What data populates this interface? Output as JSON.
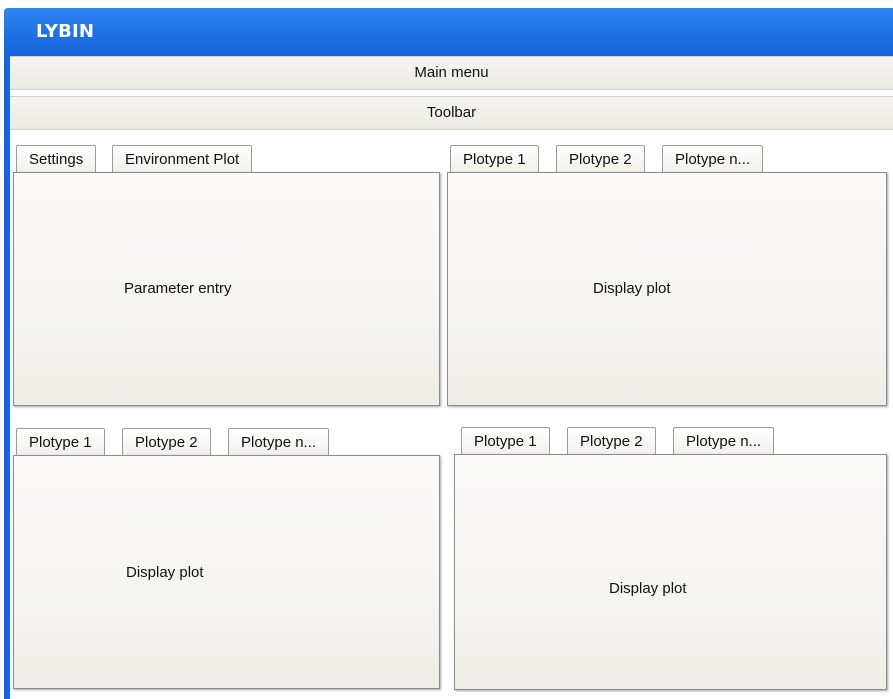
{
  "app": {
    "title": "LYBIN"
  },
  "main_menu": {
    "label": "Main menu"
  },
  "toolbar": {
    "label": "Toolbar"
  },
  "panels": {
    "top_left": {
      "tabs": [
        "Settings",
        "Environment Plot"
      ],
      "content_label": "Parameter entry"
    },
    "top_right": {
      "tabs": [
        "Plotype 1",
        "Plotype 2",
        "Plotype n..."
      ],
      "content_label": "Display plot"
    },
    "bottom_left": {
      "tabs": [
        "Plotype 1",
        "Plotype 2",
        "Plotype n..."
      ],
      "content_label": "Display plot"
    },
    "bottom_right": {
      "tabs": [
        "Plotype 1",
        "Plotype 2",
        "Plotype n..."
      ],
      "content_label": "Display plot"
    }
  },
  "colors": {
    "titlebar": "#1d6fe4",
    "window_border": "#1664e0",
    "bar_background": "#f2f1ec",
    "panel_background": "#f7f6f3"
  }
}
